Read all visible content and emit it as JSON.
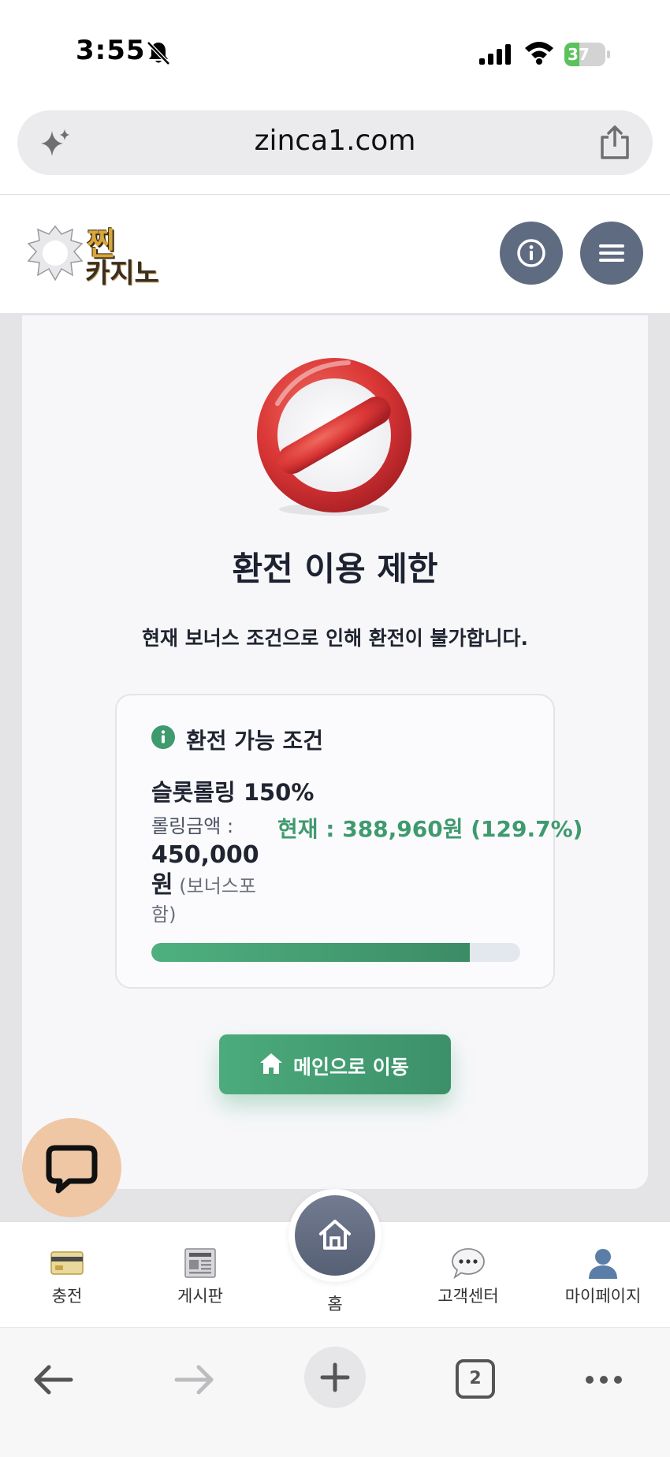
{
  "status_bar": {
    "time": "3:55",
    "battery_level": "37",
    "icons": [
      "mute-bell-icon",
      "cellular-signal-icon",
      "wifi-icon",
      "battery-charging-icon"
    ]
  },
  "browser": {
    "url": "zinca1.com",
    "tabs_count": "2"
  },
  "header": {
    "logo_line1": "찐",
    "logo_line2": "카지노"
  },
  "page": {
    "title": "환전 이용 제한",
    "subtitle": "현재 보너스 조건으로 인해 환전이 불가합니다."
  },
  "conditions": {
    "heading": "환전 가능 조건",
    "rolling_requirement": "슬롯롤링 150%",
    "amount_label": "롤링금액 :",
    "amount_value": "450,000",
    "amount_unit": "원",
    "amount_note": "(보너스포함)",
    "current_text": "현재 : 388,960원 (129.7%)",
    "progress_percent": 86.4
  },
  "main_button": {
    "label": "메인으로 이동"
  },
  "bottom_nav": {
    "items": [
      {
        "label": "충전",
        "icon": "credit-card-icon"
      },
      {
        "label": "게시판",
        "icon": "newspaper-icon"
      },
      {
        "label": "홈",
        "icon": "home-icon"
      },
      {
        "label": "고객센터",
        "icon": "speech-bubble-icon"
      },
      {
        "label": "마이페이지",
        "icon": "user-silhouette-icon"
      }
    ]
  },
  "colors": {
    "accent_green": "#4cab7c",
    "header_button": "#5e6b80",
    "ban_red": "#d93535",
    "chat_fab": "#efc7a4"
  }
}
